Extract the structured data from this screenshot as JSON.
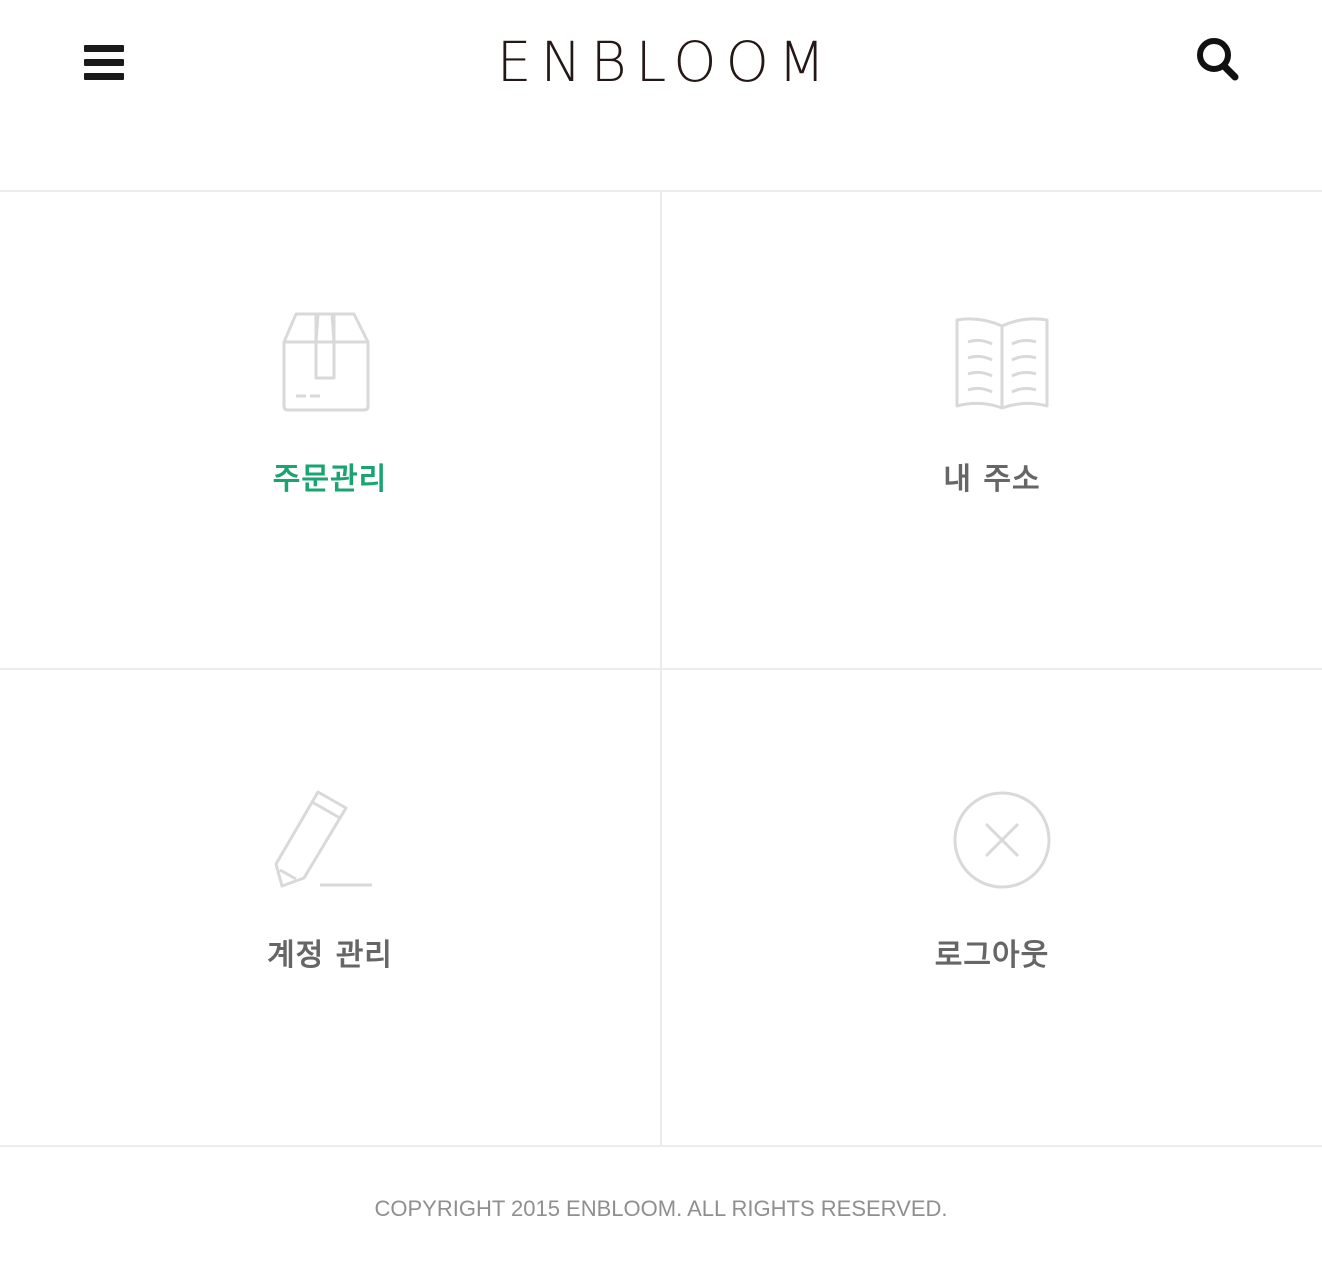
{
  "header": {
    "logo_text": "ENBLOOM",
    "menu_icon": "hamburger-menu-icon",
    "search_icon": "search-icon"
  },
  "menu_grid": [
    {
      "label": "주문관리",
      "icon": "box-icon",
      "active": true
    },
    {
      "label": "내 주소",
      "icon": "open-book-icon",
      "active": false
    },
    {
      "label": "계정 관리",
      "icon": "pencil-icon",
      "active": false
    },
    {
      "label": "로그아웃",
      "icon": "close-circle-icon",
      "active": false
    }
  ],
  "footer": {
    "copyright": "COPYRIGHT 2015 ENBLOOM. ALL RIGHTS RESERVED."
  },
  "colors": {
    "accent": "#1aa46f",
    "label": "#666666",
    "icon_stroke": "#d9d9d9",
    "divider": "#ececec",
    "logo": "#231815"
  }
}
